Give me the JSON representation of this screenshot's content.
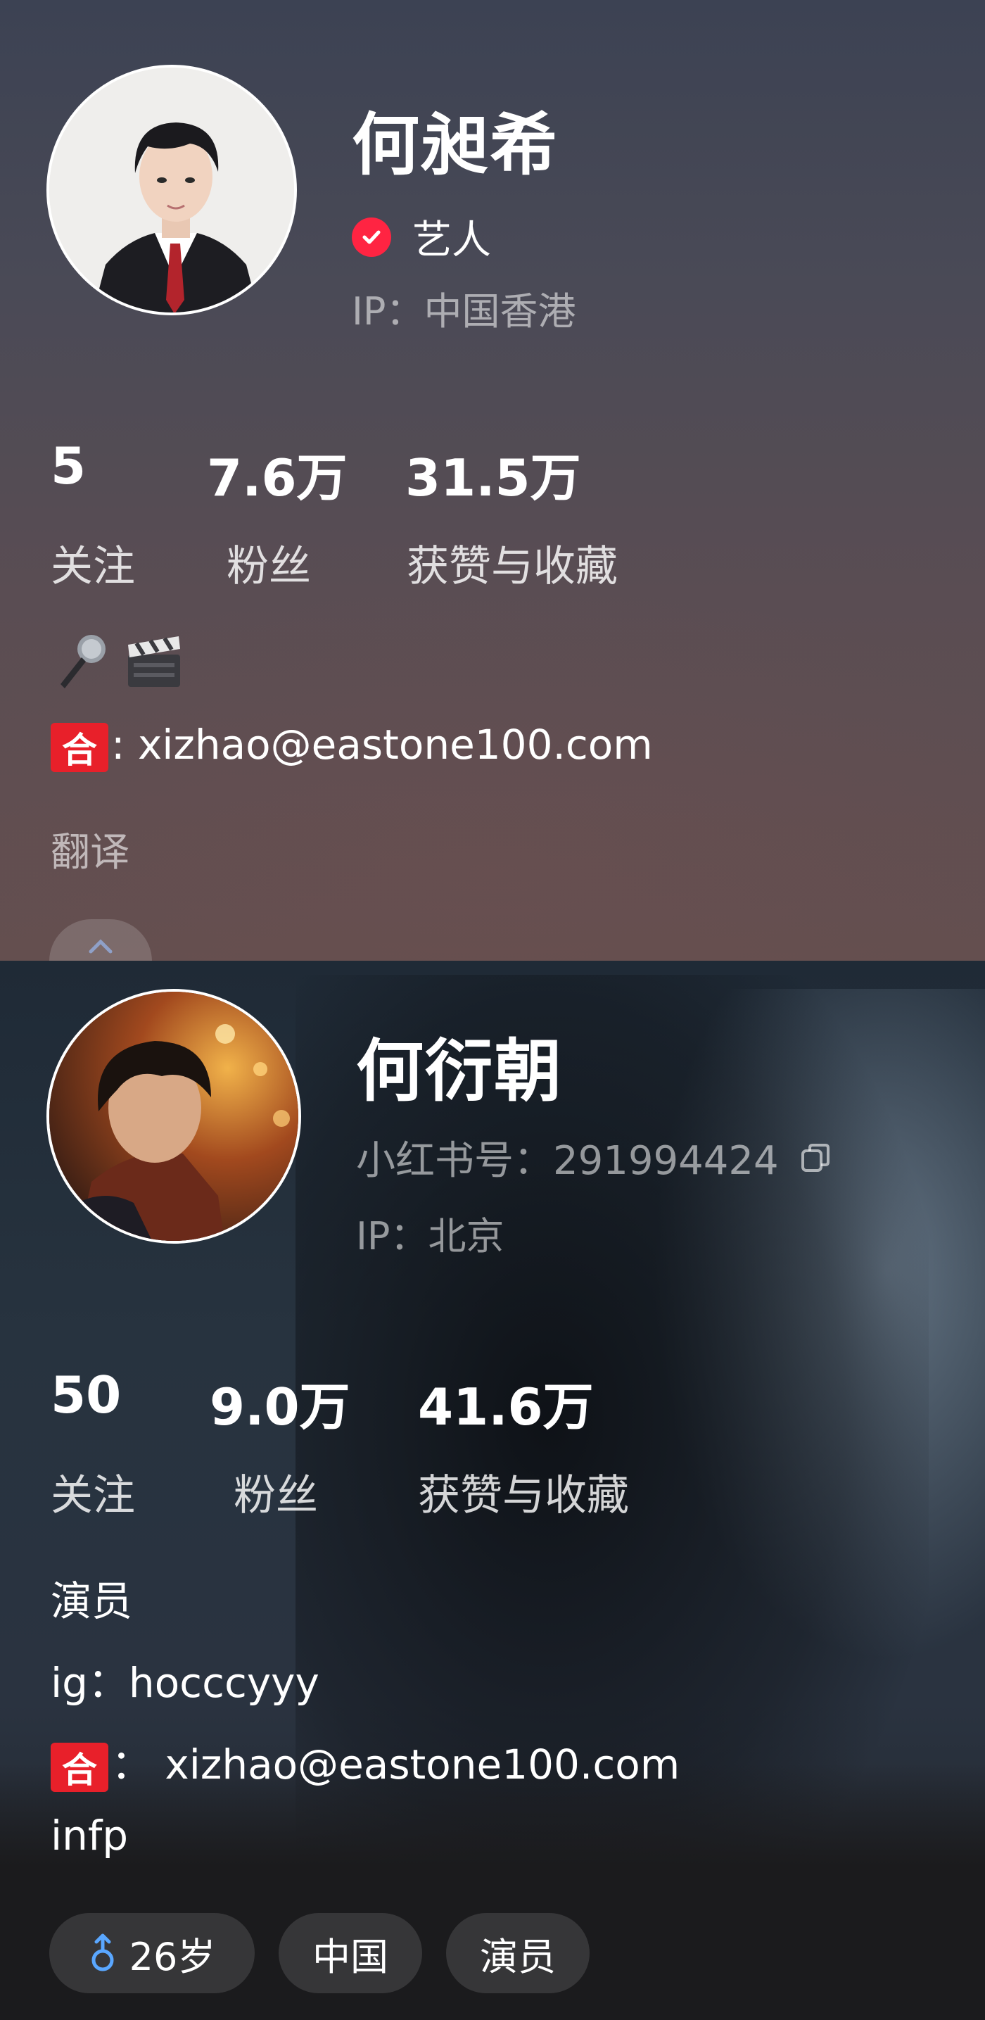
{
  "profile1": {
    "name": "何昶希",
    "verified_label": "艺人",
    "ip": "IP：中国香港",
    "stats": [
      {
        "value": "5",
        "label": "关注"
      },
      {
        "value": "7.6万",
        "label": "粉丝"
      },
      {
        "value": "31.5万",
        "label": "获赞与收藏"
      }
    ],
    "bio_emojis": [
      "microphone",
      "clapper-board"
    ],
    "bio_contact_badge": "合",
    "bio_contact": ": xizhao@eastone100.com",
    "translate_label": "翻译"
  },
  "profile2": {
    "name": "何衍朝",
    "xhs_id": "小红书号：291994424",
    "ip": "IP：北京",
    "stats": [
      {
        "value": "50",
        "label": "关注"
      },
      {
        "value": "9.0万",
        "label": "粉丝"
      },
      {
        "value": "41.6万",
        "label": "获赞与收藏"
      }
    ],
    "bio_lines": [
      "演员",
      "ig：hocccyyy"
    ],
    "bio_contact_badge": "合",
    "bio_contact": "： xizhao@eastone100.com",
    "bio_last": "infp",
    "tags": [
      {
        "icon": "male-icon",
        "label": "26岁"
      },
      {
        "label": "中国"
      },
      {
        "label": "演员"
      }
    ]
  },
  "colors": {
    "verify_red": "#ff2442",
    "he_badge_red": "#e8202a",
    "male_blue": "#5aa7ff"
  }
}
